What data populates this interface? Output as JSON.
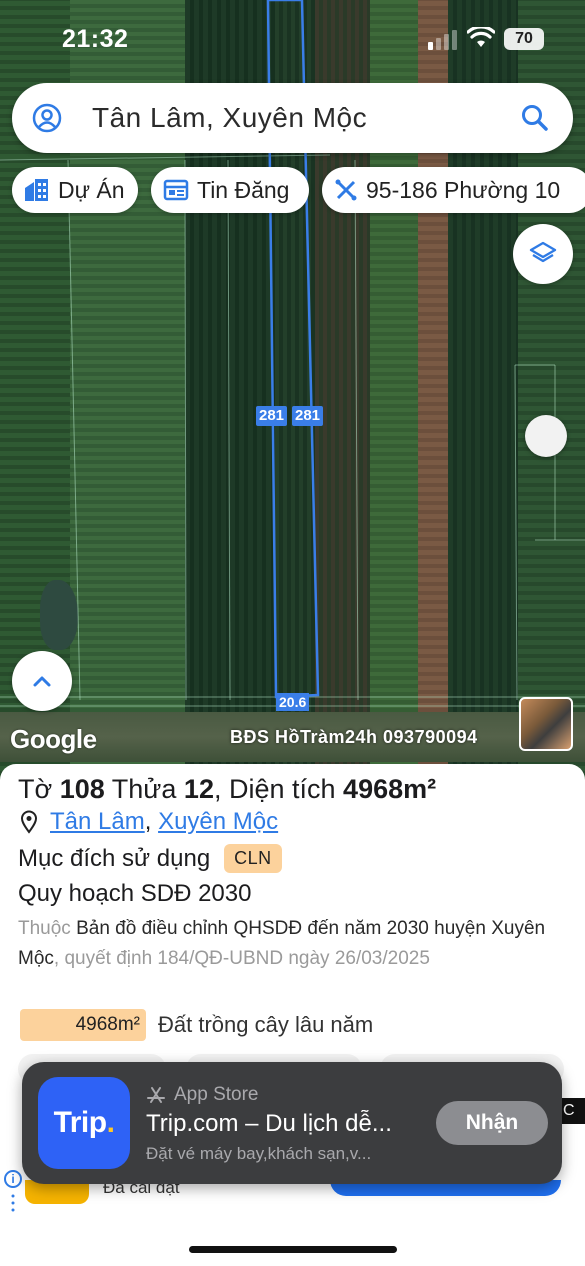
{
  "status": {
    "time": "21:32",
    "battery": "70"
  },
  "search": {
    "query": "Tân Lâm, Xuyên Mộc"
  },
  "chips": [
    {
      "label": "Dự Án",
      "icon": "building-icon"
    },
    {
      "label": "Tin Đăng",
      "icon": "listing-icon"
    },
    {
      "label": "95-186 Phường 10",
      "icon": "ruler-icon"
    }
  ],
  "map": {
    "lot_label_left": "281",
    "lot_label_right": "281",
    "dimension_label": "20.6",
    "google_logo": "Google",
    "watermark": "BĐS HồTràm24h 093790094",
    "boundary_color": "#3a7ee8"
  },
  "parcel": {
    "title_prefix": "Tờ",
    "sheet_no": "108",
    "title_mid": "Thửa",
    "lot_no": "12",
    "title_area_label": ", Diện tích",
    "area": "4968m²",
    "ward": "Tân Lâm",
    "district": "Xuyên Mộc",
    "purpose_label": "Mục đích sử dụng",
    "purpose_code": "CLN",
    "plan_title": "Quy hoạch SDĐ 2030",
    "plan_desc_prefix": "Thuộc",
    "plan_desc_name": "Bản đồ điều chỉnh QHSDĐ đến năm 2030 huyện Xuyên Mộc",
    "plan_desc_suffix": ", quyết định 184/QĐ-UBND ngày 26/03/2025",
    "area_bar_value": "4968m²",
    "area_bar_label": "Đất trồng cây lâu năm",
    "area_fraction": 1.0
  },
  "ad": {
    "app_logo_text": "Trip",
    "app_logo_dot": ".",
    "store": "App Store",
    "title": "Trip.com – Du lịch dễ...",
    "subtitle": "Đặt vé máy bay,khách sạn,v...",
    "button": "Nhận",
    "under_text": "Đã cài đặt",
    "side_text": "C"
  },
  "colors": {
    "accent": "#2f7be5",
    "cln_badge": "#fcd29c",
    "ad_bg": "#3c3d3f",
    "trip_blue": "#2e62f6"
  }
}
